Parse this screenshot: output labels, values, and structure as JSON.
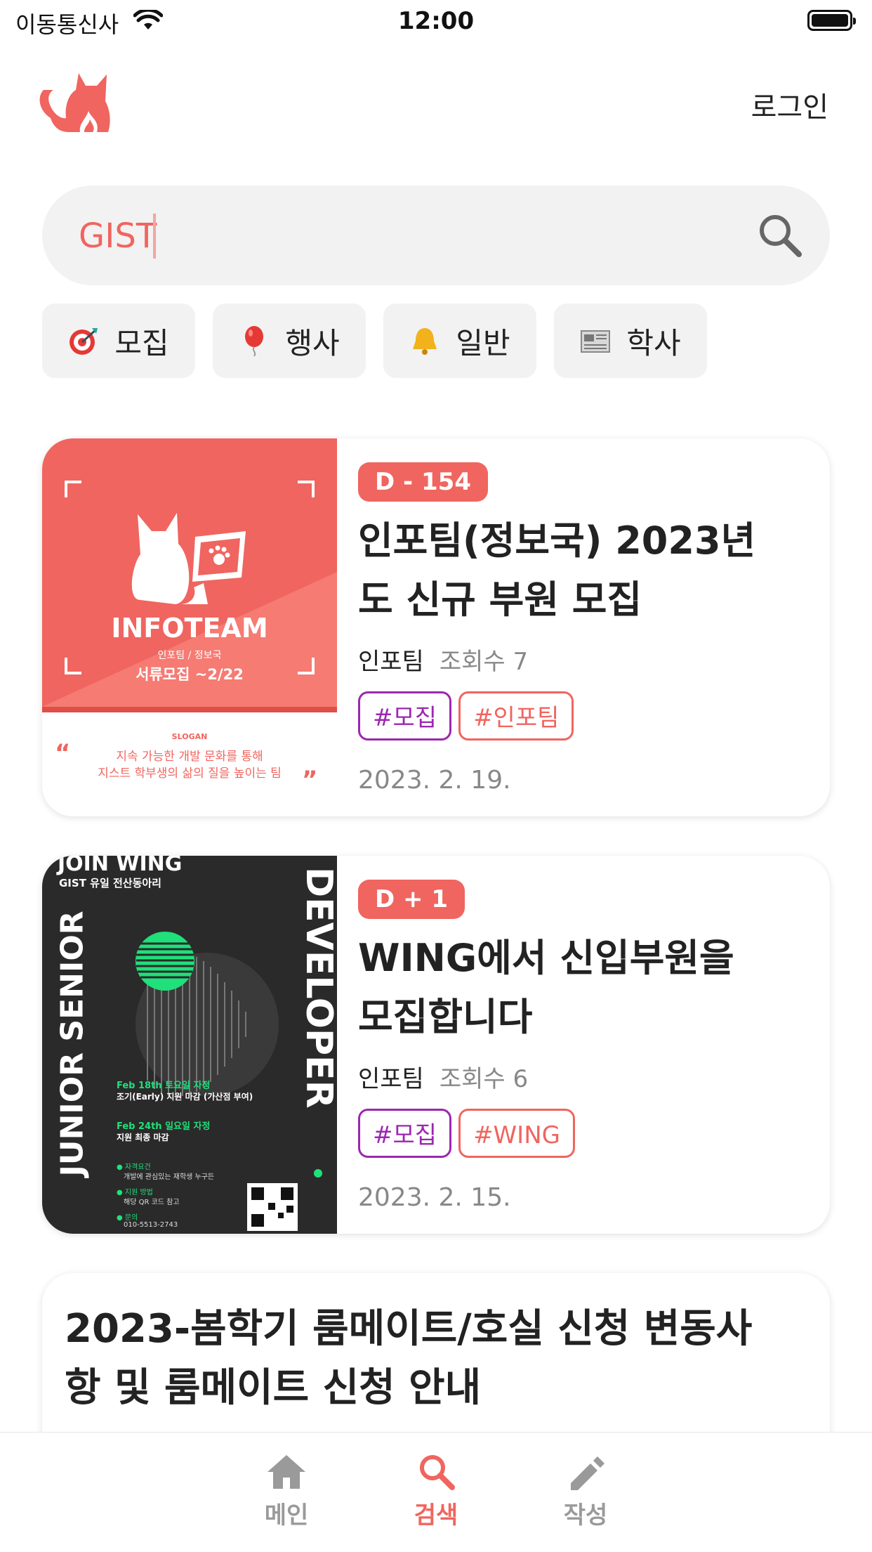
{
  "status": {
    "carrier": "이동통신사",
    "time": "12:00"
  },
  "header": {
    "login_label": "로그인",
    "logo_icon": "cat-logo-icon"
  },
  "search": {
    "query": "GIST"
  },
  "categories": [
    {
      "icon": "target-emoji",
      "label": "모집"
    },
    {
      "icon": "balloon-emoji",
      "label": "행사"
    },
    {
      "icon": "bell-emoji",
      "label": "일반"
    },
    {
      "icon": "newspaper-emoji",
      "label": "학사"
    }
  ],
  "posts": [
    {
      "badge": "D - 154",
      "title_line1": "인포팀(정보국) 2023년",
      "title_line2": "도 신규 부원 모집",
      "author": "인포팀",
      "views": "조회수 7",
      "tags": [
        "#모집",
        "#인포팀"
      ],
      "date": "2023. 2. 19.",
      "poster": {
        "team": "INFOTEAM",
        "sub": "인포팀 / 정보국",
        "deadline": "서류모집 ~2/22",
        "slogan_label": "SLOGAN",
        "slogan_line1": "지속 가능한 개발 문화를 통해",
        "slogan_line2": "지스트 학부생의 삶의 질을 높이는 팀"
      }
    },
    {
      "badge": "D + 1",
      "title_line1": "WING에서 신입부원을",
      "title_line2": "모집합니다",
      "author": "인포팀",
      "views": "조회수 6",
      "tags": [
        "#모집",
        "#WING"
      ],
      "date": "2023. 2. 15.",
      "poster": {
        "head": "JOIN WING",
        "club": "GIST 유일 전산동아리",
        "vertical_left": "JUNIOR SENIOR",
        "vertical_right": "DEVELOPER",
        "line1": "Feb 18th 토요일 자정",
        "line2": "조기(Early) 지원 마감 (가산점 부여)",
        "line3": "Feb 24th 일요일 자정",
        "line4": "지원 최종 마감",
        "info1": "● 자격요건",
        "info1b": "개발에 관심있는 재학생 누구든",
        "info2": "● 지원 방법",
        "info2b": "해당 QR 코드 참고",
        "info3": "● 문의",
        "info3b": "010-5513-2743"
      }
    },
    {
      "title_line1": "2023-봄학기 룸메이트/호실 신청 변동사",
      "title_line2": "항 및 룸메이트 신청 안내"
    }
  ],
  "tabbar": [
    {
      "label": "메인",
      "icon": "home-icon"
    },
    {
      "label": "검색",
      "icon": "search-icon"
    },
    {
      "label": "작성",
      "icon": "pencil-icon"
    }
  ],
  "colors": {
    "accent": "#f0655f",
    "purple": "#9c27b0",
    "chip_bg": "#f2f2f2",
    "wing_green": "#1fe07a"
  }
}
